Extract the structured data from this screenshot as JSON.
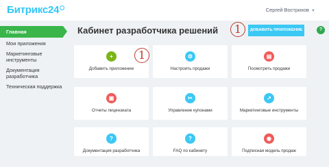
{
  "header": {
    "logo_main": "Битрикс",
    "logo_suffix": "24",
    "user_name": "Сергей Вострихов",
    "user_caret": "▼"
  },
  "sidebar": {
    "items": [
      {
        "label": "Главная",
        "active": true
      },
      {
        "label": "Мои приложения",
        "active": false
      },
      {
        "label": "Маркетинговые инструменты",
        "active": false
      },
      {
        "label": "Документация разработчика",
        "active": false
      },
      {
        "label": "Техническая поддержка",
        "active": false
      }
    ]
  },
  "main": {
    "title": "Кабинет разработчика решений",
    "add_button_label": "ДОБАВИТЬ ПРИЛОЖЕНИЕ",
    "help_glyph": "?",
    "markers": [
      "1",
      "1"
    ],
    "cards": [
      {
        "label": "Добавить приложение",
        "icon": "plus-icon",
        "glyph": "+",
        "color": "#7cb518"
      },
      {
        "label": "Настроить продажи",
        "icon": "settings-icon",
        "glyph": "⚙",
        "color": "#3bc8f5"
      },
      {
        "label": "Посмотреть продажи",
        "icon": "sales-icon",
        "glyph": "▤",
        "color": "#f05a59"
      },
      {
        "label": "Отчеты лицензиата",
        "icon": "report-icon",
        "glyph": "▣",
        "color": "#f05a59"
      },
      {
        "label": "Управление купонами",
        "icon": "coupon-icon",
        "glyph": "✂",
        "color": "#3bc8f5"
      },
      {
        "label": "Маркетинговые инструменты",
        "icon": "chart-icon",
        "glyph": "↗",
        "color": "#3bc8f5"
      },
      {
        "label": "Документация разработчика",
        "icon": "question-icon",
        "glyph": "?",
        "color": "#3bc8f5"
      },
      {
        "label": "FAQ по кабинету",
        "icon": "faq-icon",
        "glyph": "?",
        "color": "#3bc8f5"
      },
      {
        "label": "Подписная модель продаж",
        "icon": "subscription-icon",
        "glyph": "◉",
        "color": "#f05a59"
      }
    ]
  },
  "colors": {
    "accent_green": "#39b54a",
    "accent_blue": "#3bc8f5",
    "accent_red": "#f05a59",
    "marker_red": "#c0392b"
  }
}
